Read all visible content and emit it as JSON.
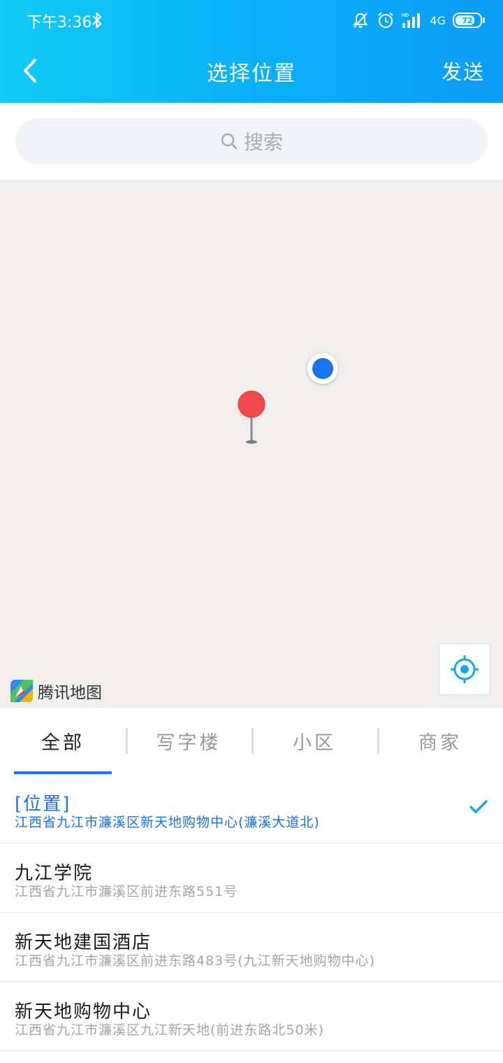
{
  "status_bar": {
    "time": "下午3:36",
    "network": "4G",
    "battery": "72"
  },
  "nav": {
    "title": "选择位置",
    "send_label": "发送"
  },
  "search": {
    "placeholder": "搜索"
  },
  "map": {
    "provider_label": "腾讯地图"
  },
  "tabs": [
    {
      "label": "全部",
      "active": true
    },
    {
      "label": "写字楼",
      "active": false
    },
    {
      "label": "小区",
      "active": false
    },
    {
      "label": "商家",
      "active": false
    }
  ],
  "locations": [
    {
      "title": "[位置]",
      "address": "江西省九江市濂溪区新天地购物中心(濂溪大道北)",
      "selected": true
    },
    {
      "title": "九江学院",
      "address": "江西省九江市濂溪区前进东路551号",
      "selected": false
    },
    {
      "title": "新天地建国酒店",
      "address": "江西省九江市濂溪区前进东路483号(九江新天地购物中心)",
      "selected": false
    },
    {
      "title": "新天地购物中心",
      "address": "江西省九江市濂溪区九江新天地(前进东路北50米)",
      "selected": false
    }
  ],
  "colors": {
    "header_start": "#10cbf5",
    "header_end": "#0b9cf6",
    "accent": "#1a73e8",
    "pin": "#f24a4a",
    "my_location": "#1a73f0"
  }
}
